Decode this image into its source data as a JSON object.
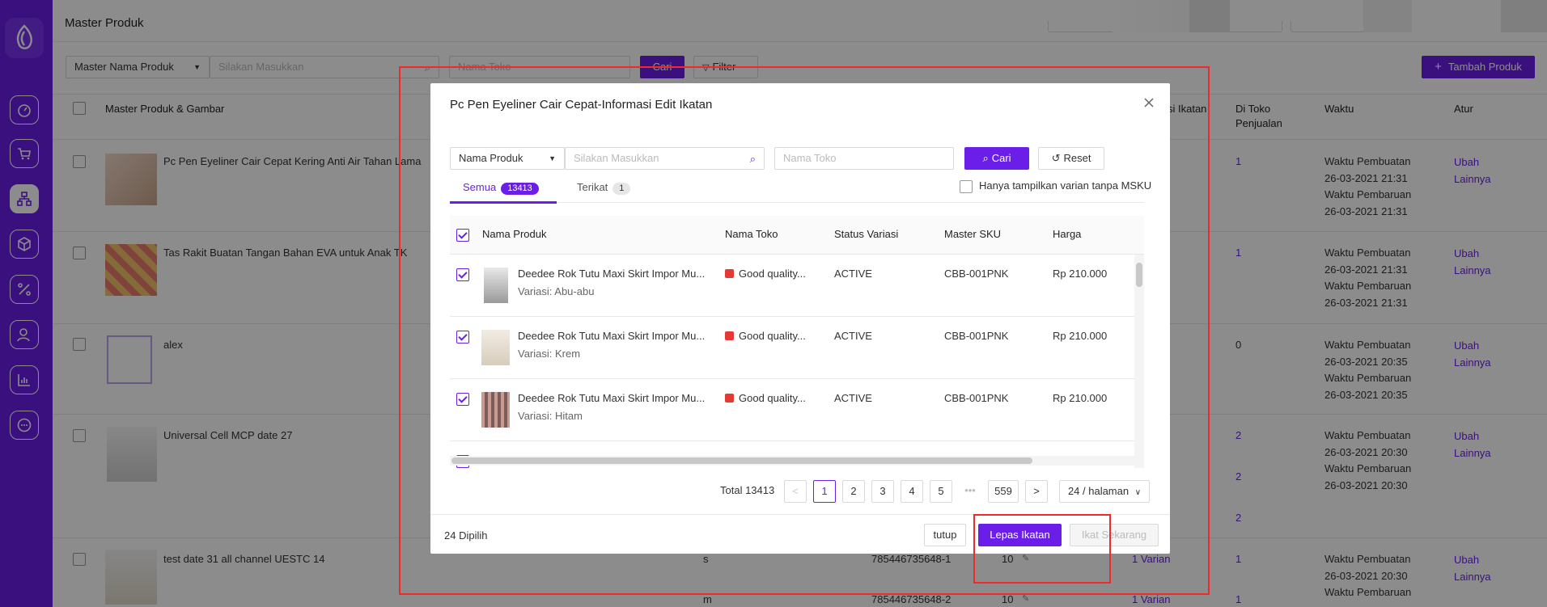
{
  "page": {
    "title": "Master Produk",
    "search_type": "Master Nama Produk",
    "search_placeholder": "Silakan Masukkan",
    "shop_placeholder": "Nama Toko",
    "search_button": "Cari",
    "filter_button": "Filter",
    "add_button": "Tambah Produk",
    "columns": [
      "Master Produk & Gambar",
      "si Ikatan",
      "Di Toko Penjualan",
      "Waktu",
      "Atur"
    ],
    "rows": [
      {
        "name": "Pc Pen Eyeliner Cair Cepat Kering Anti Air Tahan Lama",
        "count": "1",
        "time1_label": "Waktu Pembuatan",
        "time1": "26-03-2021 21:31",
        "time2_label": "Waktu Pembaruan",
        "time2": "26-03-2021 21:31",
        "edit": "Ubah",
        "more": "Lainnya"
      },
      {
        "name": "Tas Rakit Buatan Tangan Bahan EVA untuk Anak TK",
        "count": "1",
        "time1_label": "Waktu Pembuatan",
        "time1": "26-03-2021 21:31",
        "time2_label": "Waktu Pembaruan",
        "time2": "26-03-2021 21:31",
        "edit": "Ubah",
        "more": "Lainnya"
      },
      {
        "name": "alex",
        "count": "0",
        "time1_label": "Waktu Pembuatan",
        "time1": "26-03-2021 20:35",
        "time2_label": "Waktu Pembaruan",
        "time2": "26-03-2021 20:35",
        "edit": "Ubah",
        "more": "Lainnya"
      },
      {
        "name": "Universal Cell MCP date 27",
        "count": "2",
        "count2": "2",
        "count3": "2",
        "time1_label": "Waktu Pembuatan",
        "time1": "26-03-2021 20:30",
        "time2_label": "Waktu Pembaruan",
        "time2": "26-03-2021 20:30",
        "edit": "Ubah",
        "more": "Lainnya"
      },
      {
        "name": "test date 31 all channel UESTC 14",
        "variant": "s",
        "sku": "785446735648-1",
        "stock": "10",
        "varian": "1 Varian",
        "count": "1",
        "time1_label": "Waktu Pembuatan",
        "time1": "26-03-2021 20:30",
        "time2_label": "Waktu Pembaruan",
        "edit": "Ubah",
        "more": "Lainnya",
        "variant2": "m",
        "sku2": "785446735648-2",
        "stock2": "10",
        "varian2": "1 Varian",
        "count2": "1"
      }
    ]
  },
  "modal": {
    "title": "Pc Pen Eyeliner Cair Cepat-Informasi Edit Ikatan",
    "search_type": "Nama Produk",
    "search_placeholder": "Silakan Masukkan",
    "shop_placeholder": "Nama Toko",
    "search_button": "Cari",
    "reset_button": "Reset",
    "tabs": [
      {
        "label": "Semua",
        "count": "13413"
      },
      {
        "label": "Terikat",
        "count": "1"
      }
    ],
    "only_msku_label": "Hanya tampilkan varian tanpa MSKU",
    "columns": [
      "Nama Produk",
      "Nama Toko",
      "Status Variasi",
      "Master SKU",
      "Harga"
    ],
    "rows": [
      {
        "name": "Deedee Rok Tutu Maxi Skirt Impor Mu...",
        "variant": "Variasi: Abu-abu",
        "shop": "Good quality...",
        "status": "ACTIVE",
        "sku": "CBB-001PNK",
        "price": "Rp 210.000"
      },
      {
        "name": "Deedee Rok Tutu Maxi Skirt Impor Mu...",
        "variant": "Variasi: Krem",
        "shop": "Good quality...",
        "status": "ACTIVE",
        "sku": "CBB-001PNK",
        "price": "Rp 210.000"
      },
      {
        "name": "Deedee Rok Tutu Maxi Skirt Impor Mu...",
        "variant": "Variasi: Hitam",
        "shop": "Good quality...",
        "status": "ACTIVE",
        "sku": "CBB-001PNK",
        "price": "Rp 210.000"
      }
    ],
    "pagination": {
      "total_label": "Total 13413",
      "prev": "<",
      "pages": [
        "1",
        "2",
        "3",
        "4",
        "5"
      ],
      "ellipsis": "•••",
      "last": "559",
      "next": ">",
      "page_size": "24 / halaman"
    },
    "selected_label": "24 Dipilih",
    "close_button": "tutup",
    "unbind_button": "Lepas Ikatan",
    "bind_button": "Ikat Sekarang"
  },
  "colors": {
    "accent": "#6b1ee8",
    "annotation": "#f02a2a"
  }
}
